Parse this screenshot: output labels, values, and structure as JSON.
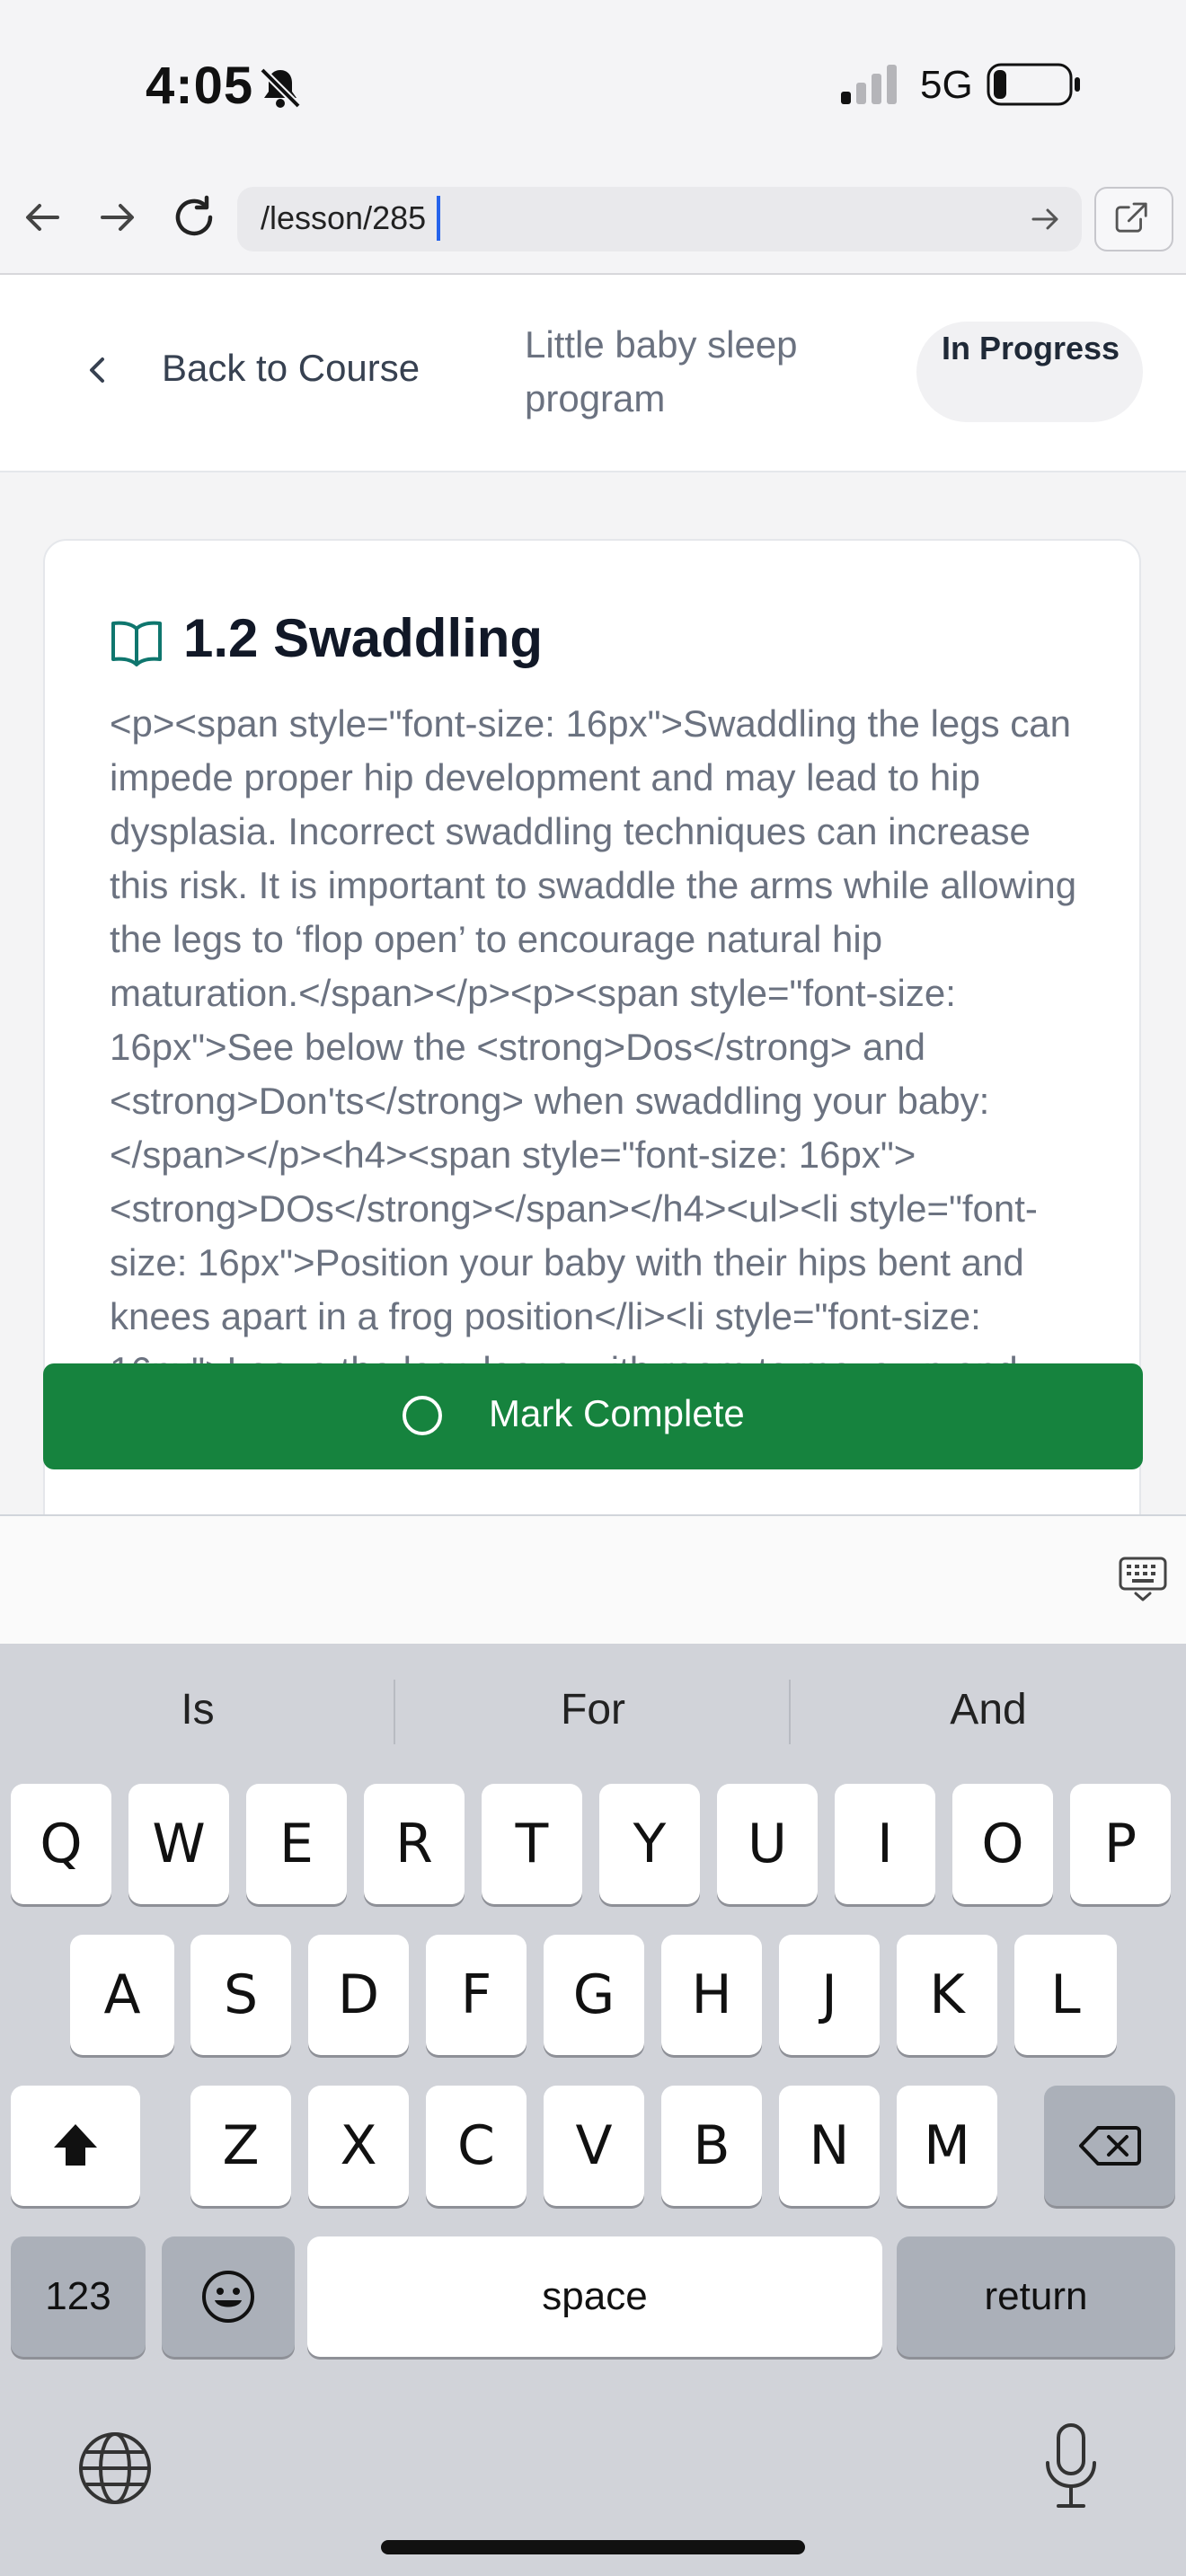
{
  "status_bar": {
    "time": "4:05",
    "network": "5G"
  },
  "browser": {
    "url": "/lesson/285"
  },
  "header": {
    "back_label": "Back to Course",
    "course_name": "Little baby sleep program",
    "status": "In Progress"
  },
  "lesson": {
    "title": "1.2 Swaddling",
    "body": "<p><span style=\"font-size: 16px\">Swaddling the legs can impede proper hip development and may lead to hip dysplasia. Incorrect swaddling techniques can increase this risk. It is important to swaddle the arms while allowing the legs to ‘flop open’ to encourage natural hip maturation.</span></p><p><span style=\"font-size: 16px\">See below the <strong>Dos</strong> and <strong>Don'ts</strong> when swaddling your baby:</span></p><h4><span style=\"font-size: 16px\"><strong>DOs</strong></span></h4><ul><li style=\"font-size: 16px\">Position your baby with their hips bent and knees apart in a frog position</li><li style=\"font-size: 16px\">Leave the legs loose with room to move up and down for free leg movement (a triangle shape, not"
  },
  "actions": {
    "mark_complete": "Mark Complete"
  },
  "keyboard": {
    "suggestions": [
      "Is",
      "For",
      "And"
    ],
    "row1": [
      "Q",
      "W",
      "E",
      "R",
      "T",
      "Y",
      "U",
      "I",
      "O",
      "P"
    ],
    "row2": [
      "A",
      "S",
      "D",
      "F",
      "G",
      "H",
      "J",
      "K",
      "L"
    ],
    "row3": [
      "Z",
      "X",
      "C",
      "V",
      "B",
      "N",
      "M"
    ],
    "numbers_key": "123",
    "space_key": "space",
    "return_key": "return"
  },
  "colors": {
    "primary_green": "#16833e",
    "keyboard_bg": "#d1d3d9"
  }
}
